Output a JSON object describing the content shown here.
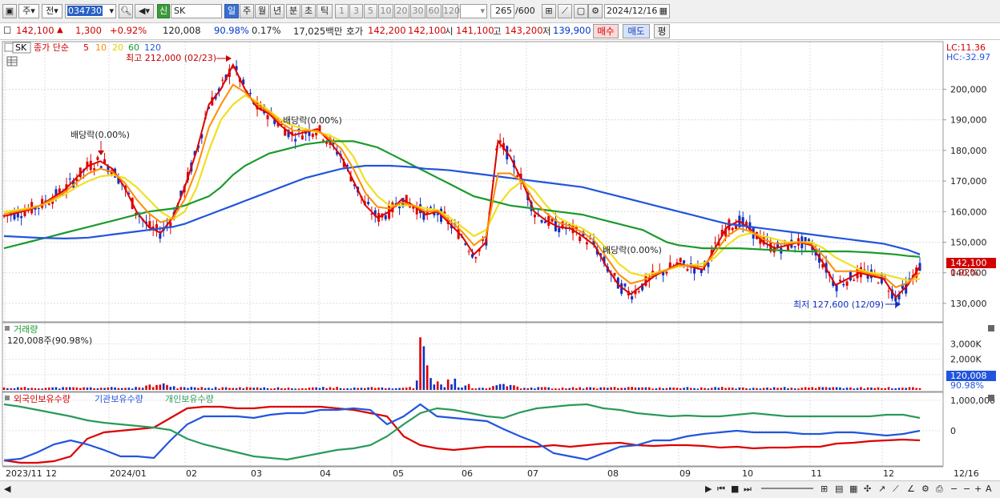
{
  "toolbar": {
    "period_jp": "주",
    "prev_label": "전",
    "code": "034730",
    "stock_name": "SK",
    "badge": "신",
    "periods": [
      "일",
      "주",
      "월",
      "년",
      "분",
      "초",
      "틱"
    ],
    "active_period": "일",
    "minutes": [
      "1",
      "3",
      "5",
      "10",
      "20",
      "30",
      "60",
      "120"
    ],
    "count": "265",
    "count_total": "/600",
    "date": "2024/12/16"
  },
  "info": {
    "price": "142,100",
    "arrow": "▲",
    "change": "1,300",
    "change_pct": "+0.92%",
    "volume": "120,008",
    "vol_ratio": "90.98%",
    "turnover": "0.17%",
    "amount": "17,025백만",
    "quote_label": "호가",
    "ask": "142,200",
    "bid": "142,100",
    "open_label": "시",
    "open": "141,100",
    "high_label": "고",
    "high": "143,200",
    "low_label": "저",
    "low": "139,900",
    "buy_label": "매수",
    "sell_label": "매도",
    "eval_label": "평"
  },
  "price_panel": {
    "symbol": "SK",
    "legend_prefix": "종가 단순",
    "ma_periods": [
      "5",
      "10",
      "20",
      "60",
      "120"
    ],
    "lc": "LC:11.36",
    "hc": "HC:-32.97",
    "high_annot": "최고 212,000 (02/23)",
    "low_annot": "최저 127,600 (12/09)",
    "dividend": "배당락(0.00%)",
    "last_price": "142,100",
    "last_pct": "0.92%",
    "y_ticks": [
      "200,000",
      "190,000",
      "180,000",
      "170,000",
      "160,000",
      "150,000",
      "140,000",
      "130,000"
    ]
  },
  "volume_panel": {
    "title": "거래량",
    "value": "120,008주(90.98%)",
    "y_ticks": [
      "3,000K",
      "2,000K",
      "1,000K"
    ],
    "last": "120,008",
    "last_pct": "90.98%"
  },
  "holdings_panel": {
    "series": [
      "외국인보유수량",
      "기관보유수량",
      "개인보유수량"
    ],
    "y_ticks": [
      "1,000,000",
      "0"
    ]
  },
  "x_axis": [
    "2023/11",
    "12",
    "2024/01",
    "02",
    "03",
    "04",
    "05",
    "06",
    "07",
    "08",
    "09",
    "10",
    "11",
    "12",
    "12/16"
  ],
  "colors": {
    "ma5": "#dd0000",
    "ma10": "#ff8c00",
    "ma20": "#f0e020",
    "ma60": "#1a9a2a",
    "ma120": "#2255dd",
    "up": "#dd0000",
    "down": "#1030c0",
    "foreign": "#dd0000",
    "institution": "#2255dd",
    "individual": "#2a9a5a"
  },
  "chart_data": {
    "type": "line",
    "title": "",
    "xlabel": "",
    "ylabel": "",
    "ylim": [
      125000,
      214000
    ],
    "x_ticks": [
      "2023/11",
      "12",
      "2024/01",
      "02",
      "03",
      "04",
      "05",
      "06",
      "07",
      "08",
      "09",
      "10",
      "11",
      "12",
      "12/16"
    ],
    "series": [
      {
        "name": "5",
        "values": [
          158500,
          159500,
          160500,
          162000,
          164500,
          167000,
          171000,
          175000,
          176500,
          174000,
          168000,
          160000,
          155000,
          153000,
          158000,
          168000,
          180000,
          195000,
          200000,
          208000,
          200000,
          194000,
          192000,
          188000,
          185000,
          186000,
          187000,
          183000,
          178000,
          170000,
          162000,
          158000,
          160000,
          164000,
          162000,
          159000,
          160000,
          156000,
          152000,
          146000,
          150000,
          183000,
          178000,
          170000,
          160000,
          157000,
          155000,
          154500,
          152000,
          149000,
          142000,
          136000,
          133000,
          136000,
          139000,
          141000,
          143000,
          142000,
          141000,
          148000,
          155000,
          157000,
          154000,
          150000,
          148000,
          149000,
          150000,
          149000,
          143000,
          136000,
          138000,
          140000,
          139000,
          138000,
          132000,
          136000,
          142100
        ]
      },
      {
        "name": "20",
        "values": [
          160000,
          160500,
          161000,
          162000,
          163500,
          165500,
          168000,
          170000,
          171500,
          172000,
          171000,
          168000,
          164000,
          160000,
          157500,
          160000,
          168000,
          180000,
          190000,
          195000,
          198000,
          196000,
          193000,
          190000,
          188000,
          187000,
          186000,
          185000,
          183000,
          178000,
          170000,
          165000,
          162000,
          162000,
          162000,
          161000,
          160500,
          158000,
          155000,
          152000,
          154000,
          162000,
          167000,
          170000,
          167000,
          162000,
          158000,
          156000,
          154500,
          152000,
          148000,
          143000,
          140000,
          139000,
          140000,
          141000,
          142000,
          142500,
          143000,
          145000,
          149000,
          152000,
          153000,
          152000,
          151000,
          150000,
          150000,
          150000,
          148000,
          145000,
          143000,
          141000,
          140000,
          139500,
          138500,
          137500,
          138000
        ]
      },
      {
        "name": "60",
        "values": [
          148000,
          149000,
          150000,
          151000,
          152000,
          153000,
          154000,
          155000,
          156000,
          157000,
          158000,
          159000,
          160000,
          160500,
          161000,
          162000,
          163500,
          165000,
          168000,
          172000,
          175000,
          177000,
          179000,
          180000,
          181000,
          182000,
          182500,
          183000,
          183000,
          183000,
          182000,
          181000,
          179000,
          177000,
          175000,
          173000,
          171000,
          169000,
          167000,
          165000,
          164000,
          163000,
          162000,
          161500,
          161000,
          160500,
          160000,
          159500,
          159000,
          158000,
          157000,
          156000,
          155000,
          154000,
          152000,
          150000,
          149000,
          148500,
          148000,
          148000,
          148000,
          148000,
          147800,
          147600,
          147400,
          147200,
          147000,
          147000,
          147000,
          147000,
          147000,
          146800,
          146600,
          146300,
          146000,
          145500,
          145200
        ]
      },
      {
        "name": "120",
        "values": [
          152000,
          151800,
          151600,
          151400,
          151300,
          151200,
          151300,
          151500,
          152000,
          152500,
          153000,
          153500,
          154000,
          154500,
          155000,
          156000,
          157500,
          159000,
          160500,
          162000,
          163500,
          165000,
          166500,
          168000,
          169500,
          171000,
          172000,
          173000,
          174000,
          174500,
          175000,
          175000,
          175000,
          174800,
          174500,
          174000,
          173800,
          173500,
          173000,
          172500,
          172000,
          171500,
          171000,
          170500,
          170000,
          169500,
          169000,
          168500,
          168000,
          167000,
          166000,
          165000,
          164000,
          163000,
          162000,
          161000,
          160000,
          159000,
          158000,
          157000,
          156000,
          155500,
          155000,
          154500,
          154000,
          153500,
          153000,
          152500,
          152000,
          151500,
          151000,
          150500,
          150000,
          149500,
          148500,
          147500,
          146000
        ]
      }
    ]
  }
}
